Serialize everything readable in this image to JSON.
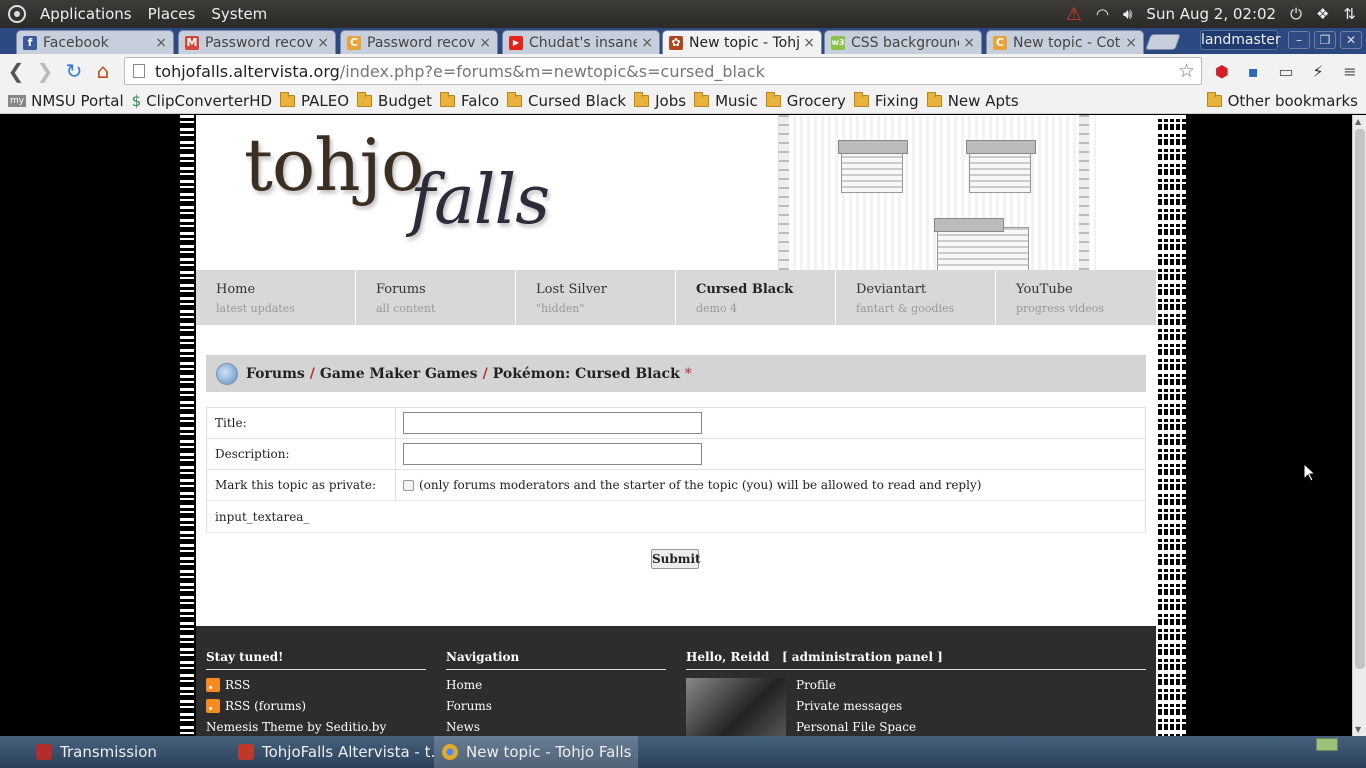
{
  "top_panel": {
    "menus": [
      "Applications",
      "Places",
      "System"
    ],
    "clock": "Sun Aug 2, 02:02"
  },
  "tabs": [
    {
      "label": "Facebook",
      "favicon_color": "#3b5998",
      "favicon_glyph": "f"
    },
    {
      "label": "Password recov",
      "favicon_color": "#d44638",
      "favicon_glyph": "M"
    },
    {
      "label": "Password recov",
      "favicon_color": "#e8a33b",
      "favicon_glyph": "C"
    },
    {
      "label": "Chudat's insane",
      "favicon_color": "#e62117",
      "favicon_glyph": "▶"
    },
    {
      "label": "New topic - Tohj",
      "favicon_color": "#b3461f",
      "favicon_glyph": "✿"
    },
    {
      "label": "CSS backgrounc",
      "favicon_color": "#8bc34a",
      "favicon_glyph": "w3"
    },
    {
      "label": "New topic - Cote",
      "favicon_color": "#e8a33b",
      "favicon_glyph": "C"
    }
  ],
  "profile_name": "landmaster",
  "omnibox": {
    "host": "tohjofalls.altervista.org",
    "path": "/index.php?e=forums&m=newtopic&s=cursed_black"
  },
  "bookmarks": {
    "items": [
      "NMSU Portal",
      "ClipConverterHD",
      "PALEO",
      "Budget",
      "Falco",
      "Cursed Black",
      "Jobs",
      "Music",
      "Grocery",
      "Fixing",
      "New Apts"
    ],
    "other": "Other bookmarks"
  },
  "site": {
    "logo_main": "tohjo",
    "logo_sub": "falls",
    "nav": [
      {
        "title": "Home",
        "sub": "latest updates"
      },
      {
        "title": "Forums",
        "sub": "all content"
      },
      {
        "title": "Lost Silver",
        "sub": "\"hidden\""
      },
      {
        "title": "Cursed Black",
        "sub": "demo 4"
      },
      {
        "title": "Deviantart",
        "sub": "fantart & goodies"
      },
      {
        "title": "YouTube",
        "sub": "progress videos"
      }
    ],
    "active_nav": "Cursed Black"
  },
  "breadcrumb": {
    "items": [
      "Forums",
      "Game Maker Games",
      "Pokémon: Cursed Black"
    ],
    "separator": "/",
    "marker": "*"
  },
  "form": {
    "title_label": "Title:",
    "title_value": "",
    "description_label": "Description:",
    "description_value": "",
    "private_label": "Mark this topic as private:",
    "private_checked": false,
    "private_note": "(only forums moderators and the starter of the topic (you) will be allowed to read and reply)",
    "textarea_placeholder": "input_textarea_",
    "submit_label": "Submit"
  },
  "footer": {
    "col1": {
      "heading": "Stay tuned!",
      "links": [
        "RSS",
        "RSS (forums)",
        "Nemesis Theme by Seditio.by"
      ]
    },
    "col2": {
      "heading": "Navigation",
      "links": [
        "Home",
        "Forums",
        "News"
      ]
    },
    "col3": {
      "heading": "Hello, Reidd",
      "admin": "[ administration panel ]",
      "links": [
        "Profile",
        "Private messages",
        "Personal File Space"
      ]
    }
  },
  "taskbar": [
    {
      "label": "Transmission",
      "icon_color": "#b12d2d"
    },
    {
      "label": "TohjoFalls Altervista - t...",
      "icon_color": "#c0382b"
    },
    {
      "label": "New topic - Tohjo Falls ...",
      "icon_color": "#e3a92a"
    }
  ]
}
